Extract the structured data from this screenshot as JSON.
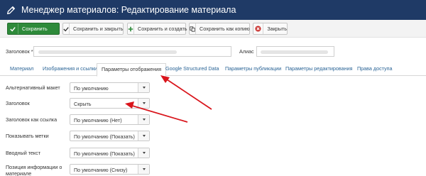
{
  "header": {
    "title": "Менеджер материалов: Редактирование материала",
    "icon": "pencil-icon"
  },
  "toolbar": {
    "save_label": "Сохранить",
    "save_close_label": "Сохранить и закрыть",
    "save_new_label": "Сохранить и создать",
    "save_copy_label": "Сохранить как копию",
    "close_label": "Закрыть"
  },
  "form": {
    "title_label": "Заголовок *",
    "alias_label": "Алиас"
  },
  "tabs": [
    {
      "label": "Материал"
    },
    {
      "label": "Изображения и ссылки"
    },
    {
      "label": "Параметры отображения",
      "active": true
    },
    {
      "label": "Google Structured Data"
    },
    {
      "label": "Параметры публикации"
    },
    {
      "label": "Параметры редактирования"
    },
    {
      "label": "Права доступа"
    }
  ],
  "fields": [
    {
      "label": "Альтернативный макет",
      "value": "По умолчанию"
    },
    {
      "label": "Заголовок",
      "value": "Скрыть"
    },
    {
      "label": "Заголовок как ссылка",
      "value": "По умолчанию (Нет)"
    },
    {
      "label": "Показывать метки",
      "value": "По умолчанию (Показать)"
    },
    {
      "label": "Вводный текст",
      "value": "По умолчанию (Показать)"
    },
    {
      "label": "Позиция информации о материале",
      "value": "По умолчанию (Снизу)"
    }
  ],
  "colors": {
    "header_bg": "#1f3a66",
    "save_green": "#2e8a3a",
    "annotation_red": "#d9141b",
    "tab_link": "#2a6496"
  }
}
